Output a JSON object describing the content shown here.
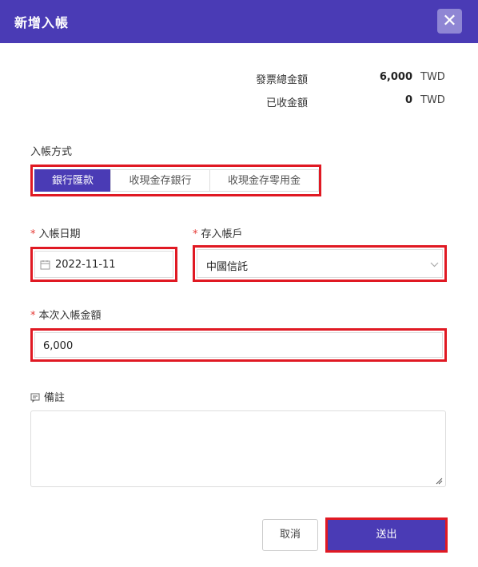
{
  "dialog": {
    "title": "新增入帳"
  },
  "summary": {
    "invoice_total_label": "發票總金額",
    "invoice_total_amount": "6,000",
    "invoice_total_currency": "TWD",
    "received_label": "已收金額",
    "received_amount": "0",
    "received_currency": "TWD"
  },
  "deposit_method": {
    "label": "入帳方式",
    "options": [
      "銀行匯款",
      "收現金存銀行",
      "收現金存零用金"
    ],
    "selected_index": 0
  },
  "date_field": {
    "label": "入帳日期",
    "value": "2022-11-11"
  },
  "account_field": {
    "label": "存入帳戶",
    "value": "中國信託"
  },
  "amount_field": {
    "label": "本次入帳金額",
    "value": "6,000"
  },
  "notes": {
    "label": "備註",
    "value": ""
  },
  "buttons": {
    "cancel": "取消",
    "submit": "送出"
  },
  "colors": {
    "primary": "#4a3bb5",
    "highlight": "#e01923"
  }
}
